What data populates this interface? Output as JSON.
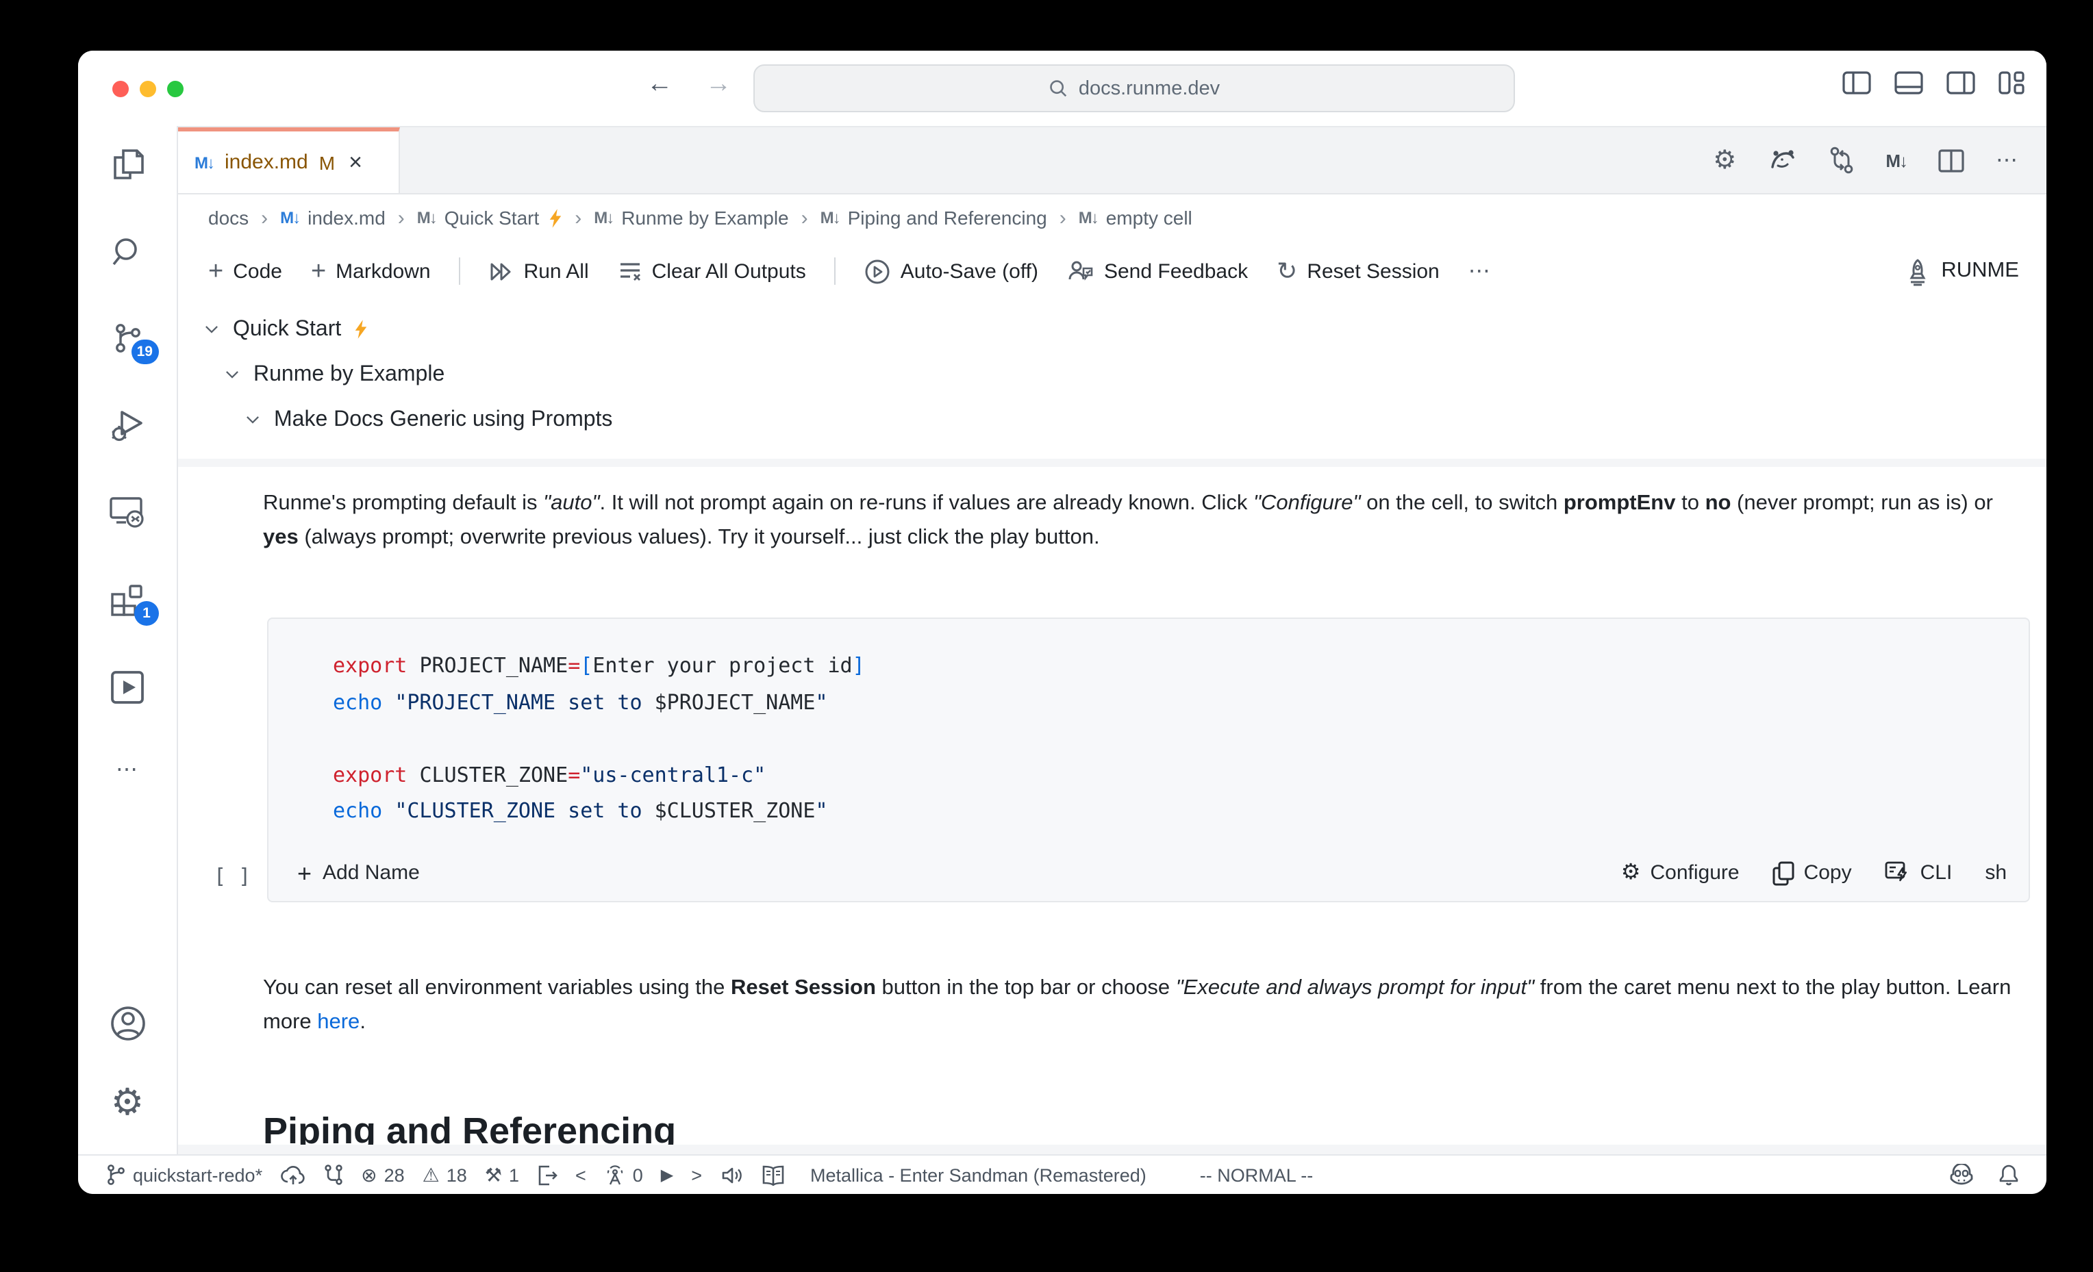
{
  "colors": {
    "tab_accent": "#f0937f",
    "badge_blue": "#1a73e8",
    "link_blue": "#0969da",
    "modified_gold": "#895503",
    "code_keyword": "#cf222e",
    "code_builtin": "#0969da",
    "code_string": "#0a3069",
    "bolt_orange": "#f6a623",
    "light_red": "#fe5f57",
    "light_yellow": "#febc2e",
    "light_green": "#28c840"
  },
  "icons": {
    "markdown_glyph": "M↓",
    "breadcrumb_sep": "›",
    "more": "⋯",
    "reset": "↻",
    "gear": "⚙",
    "plus": "+",
    "close": "×",
    "back_arrow": "←",
    "forward_arrow": "→",
    "error": "⊗",
    "warning": "⚠",
    "tools": "⚒",
    "play_filled": "▶",
    "chevron_left": "<",
    "chevron_right": ">",
    "exec_marker": "[ ]"
  },
  "titlebar": {
    "url": "docs.runme.dev"
  },
  "tab": {
    "title": "index.md",
    "modified": "M"
  },
  "breadcrumbs": [
    {
      "label": "docs",
      "icon": "none"
    },
    {
      "label": "index.md",
      "icon": "blue"
    },
    {
      "label": "Quick Start",
      "icon": "gray",
      "bolt": true
    },
    {
      "label": "Runme by Example",
      "icon": "gray"
    },
    {
      "label": "Piping and Referencing",
      "icon": "gray"
    },
    {
      "label": "empty cell",
      "icon": "gray"
    }
  ],
  "toolbar": {
    "code": "Code",
    "markdown": "Markdown",
    "run_all": "Run All",
    "clear_outputs": "Clear All Outputs",
    "autosave": "Auto-Save (off)",
    "feedback": "Send Feedback",
    "reset": "Reset Session",
    "runme": "RUNME"
  },
  "outline": [
    {
      "label": "Quick Start",
      "level": 0,
      "bolt": true
    },
    {
      "label": "Runme by Example",
      "level": 1
    },
    {
      "label": "Make Docs Generic using Prompts",
      "level": 2
    }
  ],
  "paragraph1": [
    {
      "t": "Runme's prompting default is "
    },
    {
      "t": "\"auto\"",
      "s": "i"
    },
    {
      "t": ". It will not prompt again on re-runs if values are already known. Click "
    },
    {
      "t": "\"Configure\"",
      "s": "i"
    },
    {
      "t": " on the cell, to switch "
    },
    {
      "t": "promptEnv",
      "s": "b"
    },
    {
      "t": " to "
    },
    {
      "t": "no",
      "s": "b"
    },
    {
      "t": " (never prompt; run as is) or "
    },
    {
      "t": "yes",
      "s": "b"
    },
    {
      "t": " (always prompt; overwrite previous values). Try it yourself... just click the play button."
    }
  ],
  "code_lines": [
    [
      {
        "t": "export ",
        "c": "kw"
      },
      {
        "t": "PROJECT_NAME",
        "c": "plain"
      },
      {
        "t": "=",
        "c": "kw"
      },
      {
        "t": "[",
        "c": "fn"
      },
      {
        "t": "Enter your project id",
        "c": "plain"
      },
      {
        "t": "]",
        "c": "fn"
      }
    ],
    [
      {
        "t": "echo ",
        "c": "fn"
      },
      {
        "t": "\"PROJECT_NAME set to ",
        "c": "str"
      },
      {
        "t": "$PROJECT_NAME",
        "c": "plain"
      },
      {
        "t": "\"",
        "c": "str"
      }
    ],
    [],
    [
      {
        "t": "export ",
        "c": "kw"
      },
      {
        "t": "CLUSTER_ZONE",
        "c": "plain"
      },
      {
        "t": "=",
        "c": "kw"
      },
      {
        "t": "\"us-central1-c\"",
        "c": "str"
      }
    ],
    [
      {
        "t": "echo ",
        "c": "fn"
      },
      {
        "t": "\"CLUSTER_ZONE set to ",
        "c": "str"
      },
      {
        "t": "$CLUSTER_ZONE",
        "c": "plain"
      },
      {
        "t": "\"",
        "c": "str"
      }
    ]
  ],
  "cell": {
    "add_name": "Add Name",
    "configure": "Configure",
    "copy": "Copy",
    "cli": "CLI",
    "lang": "sh"
  },
  "paragraph2": [
    {
      "t": "You can reset all environment variables using the "
    },
    {
      "t": "Reset Session",
      "s": "b"
    },
    {
      "t": " button in the top bar or choose "
    },
    {
      "t": "\"Execute and always prompt for input\"",
      "s": "i"
    },
    {
      "t": " from the caret menu next to the play button. Learn more "
    },
    {
      "t": "here",
      "s": "link"
    },
    {
      "t": "."
    }
  ],
  "heading2": "Piping and Referencing",
  "activitybar": {
    "scm_badge": "19",
    "ext_badge": "1"
  },
  "statusbar": {
    "branch": "quickstart-redo*",
    "errors": "28",
    "warnings": "18",
    "tools_count": "1",
    "tunnel_count": "0",
    "song": "Metallica - Enter Sandman (Remastered)",
    "mode": "-- NORMAL --"
  }
}
